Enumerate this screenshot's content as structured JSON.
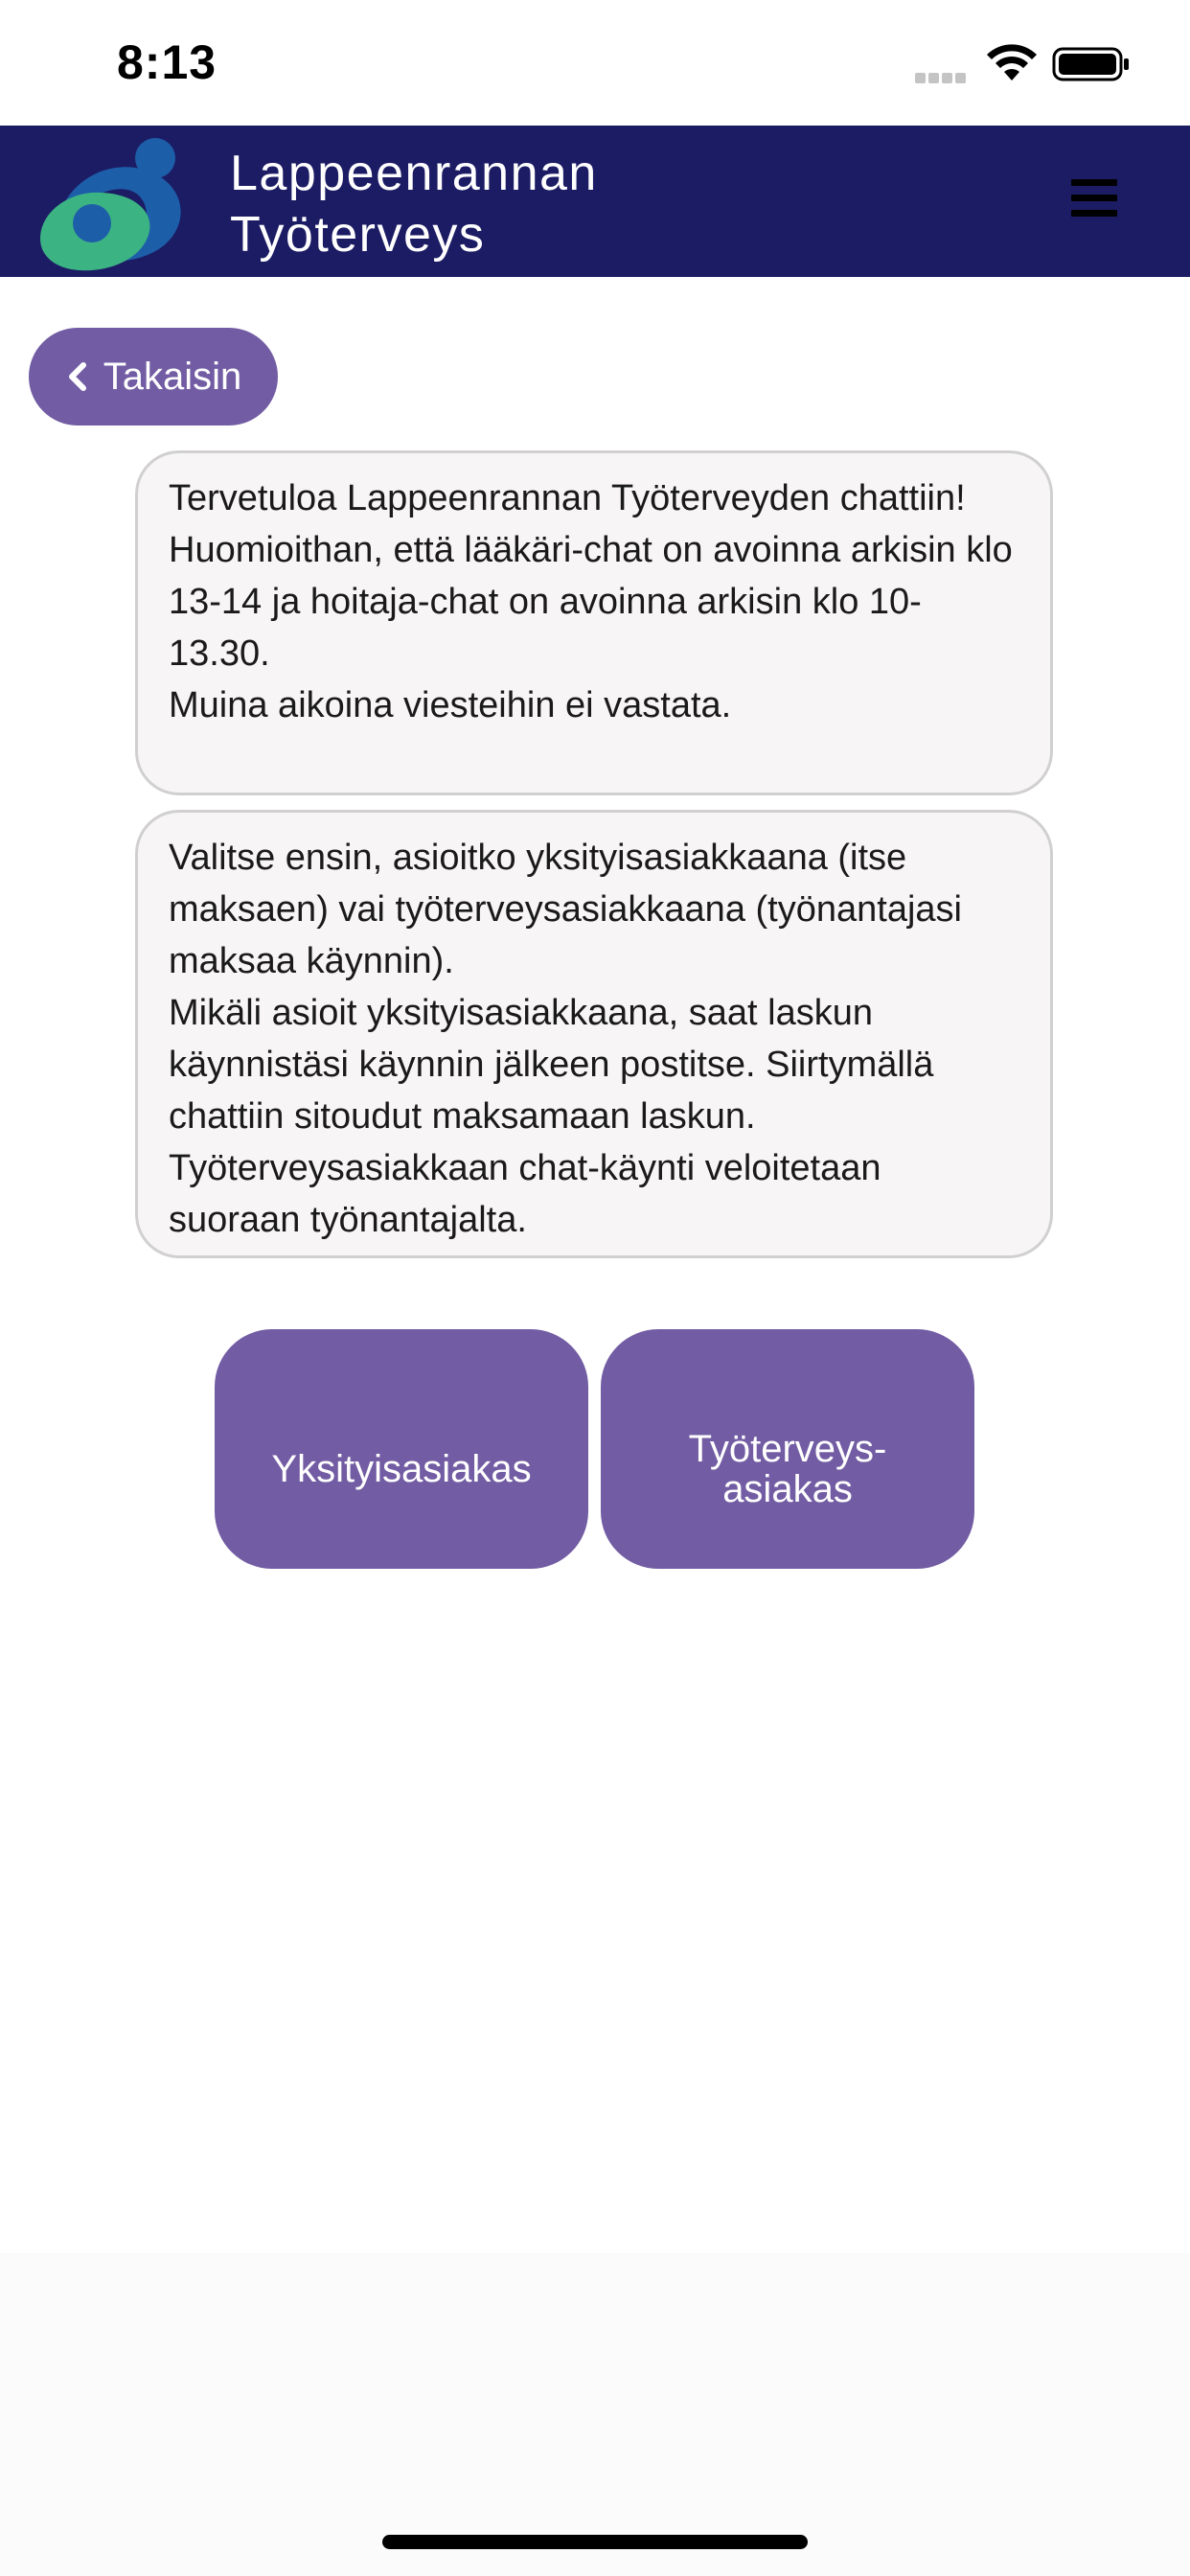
{
  "status_bar": {
    "time": "8:13"
  },
  "header": {
    "brand_line1": "Lappeenrannan",
    "brand_line2": "Työterveys",
    "menu_icon": "hamburger-menu-icon"
  },
  "navigation": {
    "back_label": "Takaisin",
    "back_icon": "chevron-left-icon"
  },
  "messages": [
    {
      "lines": [
        "Tervetuloa Lappeenrannan Työterveyden chattiin!",
        "Huomioithan, että lääkäri-chat on avoinna arkisin klo 13-14 ja hoitaja-chat on avoinna arkisin klo 10-13.30.",
        "Muina aikoina viesteihin ei vastata."
      ]
    },
    {
      "lines": [
        "Valitse ensin, asioitko yksityisasiakkaana (itse maksaen) vai työterveysasiakkaana (työnantajasi maksaa käynnin).",
        "Mikäli asioit yksityisasiakkaana, saat laskun käynnistäsi käynnin jälkeen postitse. Siirtymällä chattiin sitoudut maksamaan laskun.",
        "Työterveysasiakkaan chat-käynti veloitetaan suoraan työnantajalta."
      ]
    }
  ],
  "choices": {
    "private_label": "Yksityisasiakas",
    "occupational_label_line1": "Työterveys-",
    "occupational_label_line2": "asiakas"
  },
  "colors": {
    "header_bg": "#1c1c65",
    "button_bg": "#725ca3",
    "logo_blue": "#1d5ea8",
    "logo_green": "#3cb383"
  }
}
